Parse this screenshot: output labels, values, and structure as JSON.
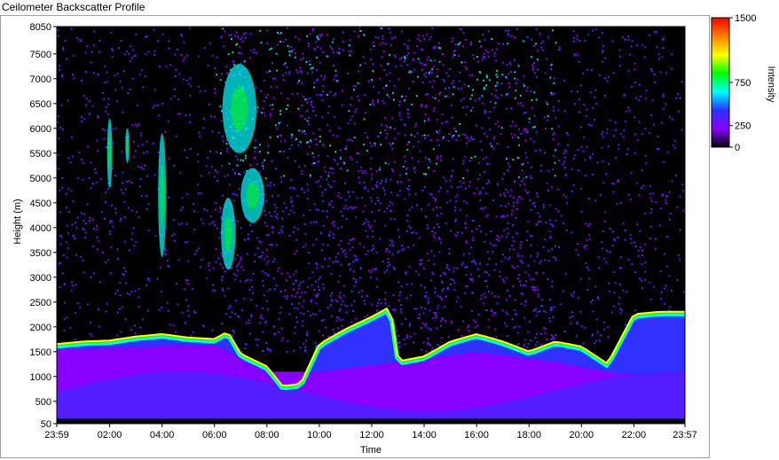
{
  "window": {
    "title": "Ceilometer Backscatter Profile"
  },
  "chart_data": {
    "type": "heatmap",
    "title": "",
    "xlabel": "Time",
    "ylabel": "Height (m)",
    "x_ticks": [
      "23:59",
      "02:00",
      "04:00",
      "06:00",
      "08:00",
      "10:00",
      "12:00",
      "14:00",
      "16:00",
      "18:00",
      "20:00",
      "22:00",
      "23:57"
    ],
    "y_ticks": [
      50,
      500,
      1000,
      1500,
      2000,
      2500,
      3000,
      3500,
      4000,
      4500,
      5000,
      5500,
      6000,
      6500,
      7000,
      7500,
      8050
    ],
    "x_range_hours": [
      -0.0167,
      23.95
    ],
    "y_range": [
      50,
      8050
    ],
    "colorbar": {
      "label": "Intensity",
      "range": [
        0,
        1500
      ],
      "ticks": [
        0,
        250,
        750,
        1500
      ],
      "colors": [
        "#000000",
        "#8800ff",
        "#3030ff",
        "#00ffff",
        "#00ff00",
        "#ffff00",
        "#ff8000",
        "#ff0000"
      ]
    },
    "layers": {
      "mixing_layer_top": [
        {
          "t": 0.0,
          "h": 1650
        },
        {
          "t": 1.0,
          "h": 1700
        },
        {
          "t": 2.0,
          "h": 1720
        },
        {
          "t": 3.0,
          "h": 1800
        },
        {
          "t": 4.0,
          "h": 1850
        },
        {
          "t": 5.0,
          "h": 1780
        },
        {
          "t": 6.0,
          "h": 1750
        },
        {
          "t": 6.5,
          "h": 1900
        },
        {
          "t": 7.0,
          "h": 1450
        },
        {
          "t": 8.0,
          "h": 1200
        },
        {
          "t": 8.6,
          "h": 800
        },
        {
          "t": 9.3,
          "h": 850
        },
        {
          "t": 10.0,
          "h": 1650
        },
        {
          "t": 11.0,
          "h": 1950
        },
        {
          "t": 12.0,
          "h": 2200
        },
        {
          "t": 12.7,
          "h": 2400
        },
        {
          "t": 13.0,
          "h": 1300
        },
        {
          "t": 14.0,
          "h": 1400
        },
        {
          "t": 15.0,
          "h": 1700
        },
        {
          "t": 16.0,
          "h": 1850
        },
        {
          "t": 17.0,
          "h": 1700
        },
        {
          "t": 18.0,
          "h": 1500
        },
        {
          "t": 19.0,
          "h": 1700
        },
        {
          "t": 20.0,
          "h": 1600
        },
        {
          "t": 21.0,
          "h": 1250
        },
        {
          "t": 22.0,
          "h": 2250
        },
        {
          "t": 23.0,
          "h": 2300
        }
      ],
      "aerosol_top": [
        {
          "t": 0.0,
          "h": 1550
        },
        {
          "t": 6.0,
          "h": 1650
        },
        {
          "t": 8.0,
          "h": 1100
        },
        {
          "t": 10.0,
          "h": 1100
        },
        {
          "t": 13.0,
          "h": 1300
        },
        {
          "t": 16.0,
          "h": 1500
        },
        {
          "t": 19.0,
          "h": 1300
        },
        {
          "t": 21.5,
          "h": 1050
        },
        {
          "t": 23.95,
          "h": 1100
        }
      ],
      "clouds": [
        {
          "t0": 1.9,
          "t1": 2.1,
          "h0": 4800,
          "h1": 6200
        },
        {
          "t0": 2.6,
          "t1": 2.75,
          "h0": 5300,
          "h1": 6000
        },
        {
          "t0": 3.85,
          "t1": 4.15,
          "h0": 3400,
          "h1": 5900
        },
        {
          "t0": 6.25,
          "t1": 6.8,
          "h0": 3150,
          "h1": 4600
        },
        {
          "t0": 6.3,
          "t1": 7.6,
          "h0": 5500,
          "h1": 7300
        },
        {
          "t0": 7.0,
          "t1": 7.9,
          "h0": 4100,
          "h1": 5200
        }
      ]
    }
  }
}
